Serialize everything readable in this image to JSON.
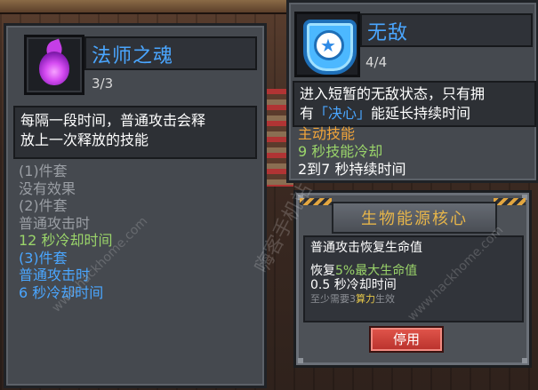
{
  "left_card": {
    "name": "法师之魂",
    "count": "3/3",
    "description": [
      "每隔一段时间，普通攻击会释",
      "放上一次释放的技能"
    ],
    "set_lines": [
      {
        "text": "(1)件套",
        "color": "grey"
      },
      {
        "text": "没有效果",
        "color": "grey"
      },
      {
        "text": "(2)件套",
        "color": "grey"
      },
      {
        "text": "普通攻击时",
        "color": "grey"
      },
      {
        "text": "12 秒冷却时间",
        "color": "green"
      },
      {
        "text": "(3)件套",
        "color": "blue"
      },
      {
        "text": "普通攻击时",
        "color": "blue"
      },
      {
        "text": "6 秒冷却时间",
        "color": "blue"
      }
    ],
    "icon": "purple-soul-icon"
  },
  "right_card": {
    "name": "无敌",
    "count": "4/4",
    "description_line1": "进入短暂的无敌状态，只有拥",
    "description_line2_pre": "有",
    "description_line2_quote": "「决心」",
    "description_line2_post": "能延长持续时间",
    "type_label": "主动技能",
    "cooldown": "9 秒技能冷却",
    "duration": "2到7 秒持续时间",
    "icon": "blue-star-shield-icon"
  },
  "modal": {
    "title": "生物能源核心",
    "line1": "普通攻击恢复生命值",
    "line2_pre": "恢复",
    "line2_value": "5%最大生命值",
    "line3": "0.5 秒冷却时间",
    "line4_pre": "至少需要3",
    "line4_highlight": "算力",
    "line4_post": "生效",
    "button": "停用"
  },
  "watermarks": {
    "center": "嗨客手机站",
    "left_diag": "www.hackhome.com",
    "right_diag": "www.hackhome.com"
  },
  "colors": {
    "blue_text": "#4aa6ff",
    "green_text": "#9ad46a",
    "orange_text": "#f2a53a",
    "title_gold": "#e6b54a",
    "button_red": "#c8413a"
  }
}
